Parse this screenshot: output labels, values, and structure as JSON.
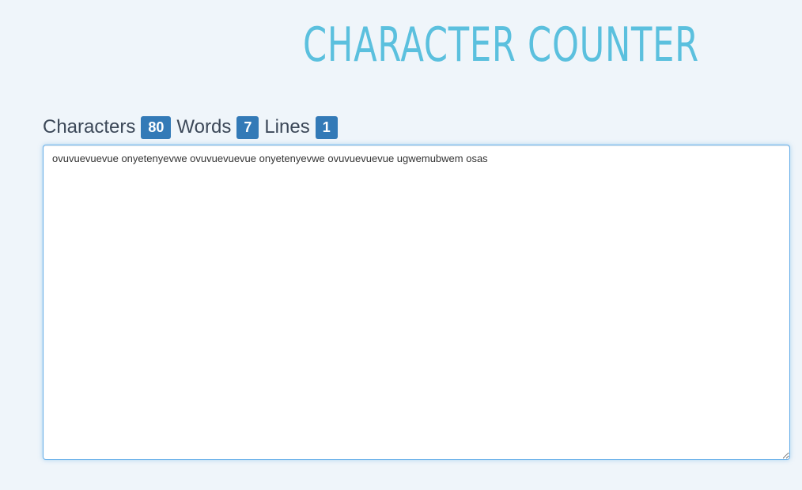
{
  "header": {
    "title": "CHARACTER COUNTER"
  },
  "stats": {
    "characters_label": "Characters",
    "characters_count": "80",
    "words_label": "Words",
    "words_count": "7",
    "lines_label": "Lines",
    "lines_count": "1"
  },
  "editor": {
    "value": "ovuvuevuevue onyetenyevwe ovuvuevuevue onyetenyevwe ovuvuevuevue ugwemubwem osas"
  },
  "colors": {
    "title": "#5bc0de",
    "badge": "#337ab7",
    "background": "#eff5fa",
    "focus_border": "#66afe9"
  }
}
